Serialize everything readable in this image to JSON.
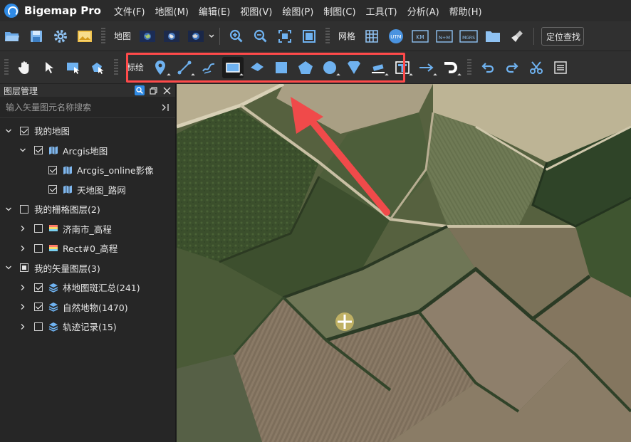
{
  "app": {
    "title": "Bigemap Pro"
  },
  "menu": [
    "文件(F)",
    "地图(M)",
    "编辑(E)",
    "视图(V)",
    "绘图(P)",
    "制图(C)",
    "工具(T)",
    "分析(A)",
    "帮助(H)"
  ],
  "toolbar1": {
    "map_label": "地图",
    "grid_label": "网格",
    "location_input": "定位查找",
    "grid_buttons": [
      "UTM",
      "KM",
      "N+M",
      "MGRS"
    ]
  },
  "toolbar2": {
    "draw_label": "标绘"
  },
  "layer_panel": {
    "title": "图层管理",
    "search_placeholder": "输入矢量图元名称搜索",
    "tree": [
      {
        "label": "我的地图",
        "level": 0,
        "expanded": true,
        "check": "checked",
        "icon": "none"
      },
      {
        "label": "Arcgis地图",
        "level": 1,
        "expanded": true,
        "check": "checked",
        "icon": "map-icon"
      },
      {
        "label": "Arcgis_online影像",
        "level": 2,
        "expanded": null,
        "check": "checked",
        "icon": "map-icon"
      },
      {
        "label": "天地图_路网",
        "level": 2,
        "expanded": null,
        "check": "checked",
        "icon": "map-icon"
      },
      {
        "label": "我的栅格图层(2)",
        "level": 0,
        "expanded": true,
        "check": "unchecked",
        "icon": "none"
      },
      {
        "label": "济南市_高程",
        "level": 1,
        "expanded": false,
        "check": "unchecked",
        "icon": "raster-icon"
      },
      {
        "label": "Rect#0_高程",
        "level": 1,
        "expanded": false,
        "check": "unchecked",
        "icon": "raster-icon"
      },
      {
        "label": "我的矢量图层(3)",
        "level": 0,
        "expanded": true,
        "check": "partial",
        "icon": "none"
      },
      {
        "label": "林地图斑汇总(241)",
        "level": 1,
        "expanded": false,
        "check": "checked",
        "icon": "layers-icon"
      },
      {
        "label": "自然地物(1470)",
        "level": 1,
        "expanded": false,
        "check": "checked",
        "icon": "layers-icon"
      },
      {
        "label": "轨迹记录(15)",
        "level": 1,
        "expanded": false,
        "check": "unchecked",
        "icon": "layers-icon"
      }
    ]
  },
  "colors": {
    "highlight": "#ff4a4a",
    "accent": "#2f8be6",
    "panel_bg": "#262626",
    "toolbar_bg": "#303030"
  }
}
